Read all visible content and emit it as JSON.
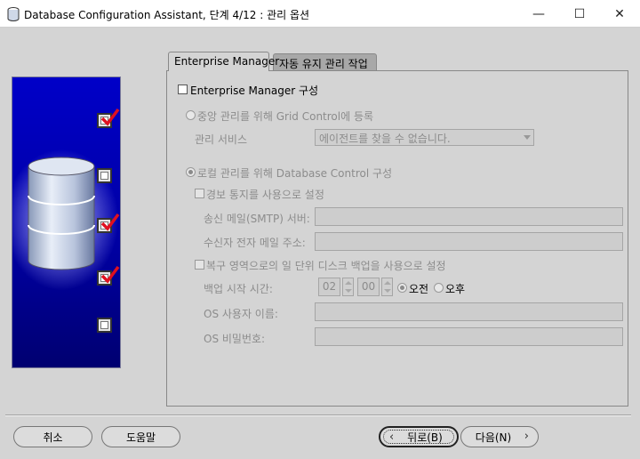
{
  "window": {
    "title": "Database Configuration Assistant, 단계 4/12 : 관리 옵션",
    "controls": {
      "minimize": "—",
      "maximize": "☐",
      "close": "✕"
    }
  },
  "side_steps": [
    {
      "state": "checked"
    },
    {
      "state": "unchecked"
    },
    {
      "state": "checked"
    },
    {
      "state": "checked"
    },
    {
      "state": "unchecked"
    }
  ],
  "tabs": [
    {
      "label": "Enterprise Manager",
      "active": true
    },
    {
      "label": "자동 유지 관리 작업",
      "active": false
    }
  ],
  "em": {
    "configure_label": "Enterprise Manager 구성",
    "configure_checked": false,
    "grid_radio_label": "중앙 관리를 위해 Grid Control에 등록",
    "mgmt_service_label": "관리 서비스",
    "mgmt_service_value": "에이전트를 찾을 수 없습니다.",
    "local_radio_label": "로컬 관리를 위해 Database Control 구성",
    "alerts_label": "경보 통지를 사용으로 설정",
    "smtp_label": "송신 메일(SMTP) 서버:",
    "smtp_value": "",
    "recipient_label": "수신자 전자 메일 주소:",
    "recipient_value": "",
    "backup_label": "복구 영역으로의 일 단위 디스크 백업을 사용으로 설정",
    "backup_time_label": "백업 시작 시간:",
    "backup_hour": "02",
    "backup_minute": "00",
    "am_label": "오전",
    "pm_label": "오후",
    "os_user_label": "OS 사용자 이름:",
    "os_user_value": "",
    "os_password_label": "OS 비밀번호:",
    "os_password_value": ""
  },
  "buttons": {
    "cancel": "취소",
    "help": "도움말",
    "back": "뒤로(B)",
    "next": "다음(N)"
  },
  "colors": {
    "side_panel": "#0000c8",
    "check_mark": "#e01020",
    "window_bg": "#d4d4d4",
    "disabled_text": "#8c8c8c"
  }
}
